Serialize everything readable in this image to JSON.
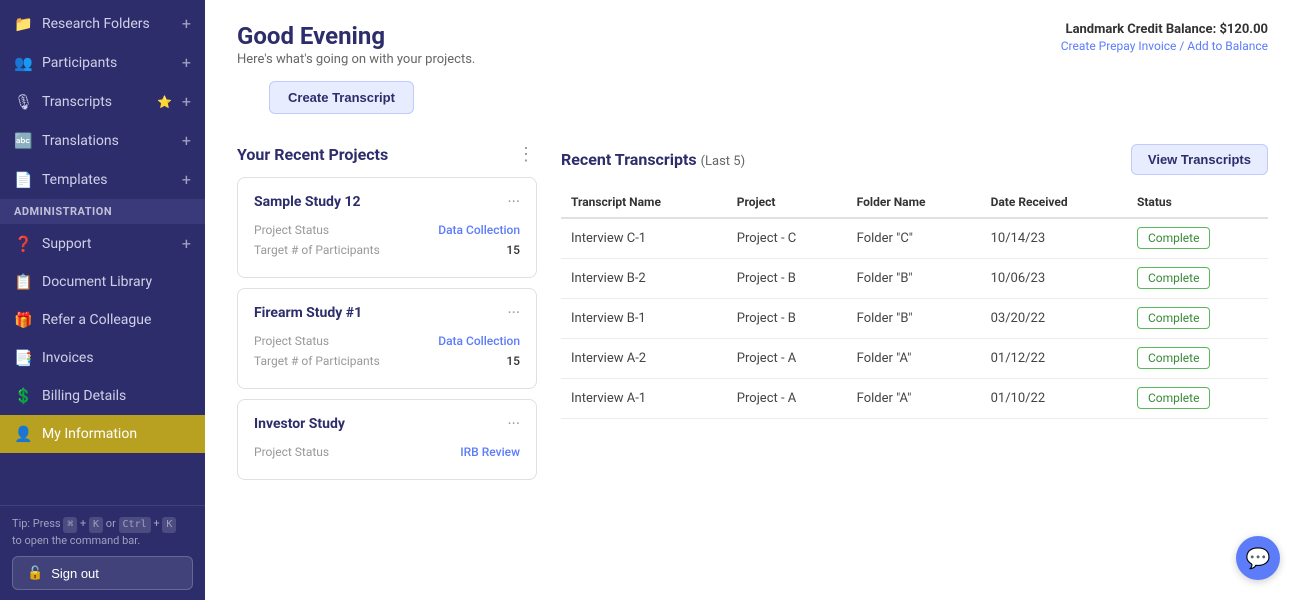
{
  "sidebar": {
    "items": [
      {
        "id": "research-folders",
        "label": "Research Folders",
        "icon": "📁",
        "has_plus": true
      },
      {
        "id": "participants",
        "label": "Participants",
        "icon": "👥",
        "has_plus": true
      },
      {
        "id": "transcripts",
        "label": "Transcripts",
        "icon": "🎙",
        "has_plus": true,
        "has_star": true
      },
      {
        "id": "translations",
        "label": "Translations",
        "icon": "🔤",
        "has_plus": true
      },
      {
        "id": "templates",
        "label": "Templates",
        "icon": "📄",
        "has_plus": true
      }
    ],
    "admin_label": "ADMINISTRATION",
    "admin_items": [
      {
        "id": "support",
        "label": "Support",
        "icon": "❓",
        "has_plus": true
      },
      {
        "id": "document-library",
        "label": "Document Library",
        "icon": "📋",
        "has_plus": false
      },
      {
        "id": "refer-colleague",
        "label": "Refer a Colleague",
        "icon": "🎁",
        "has_plus": false
      },
      {
        "id": "invoices",
        "label": "Invoices",
        "icon": "📑",
        "has_plus": false
      },
      {
        "id": "billing-details",
        "label": "Billing Details",
        "icon": "💲",
        "has_plus": false
      },
      {
        "id": "my-information",
        "label": "My Information",
        "icon": "👤",
        "has_plus": false,
        "active": true
      }
    ],
    "tip_text": "Tip: Press",
    "tip_keys": [
      "⌘",
      "K",
      "Ctrl",
      "K"
    ],
    "tip_suffix": "to open the command bar.",
    "sign_out_label": "Sign out"
  },
  "header": {
    "greeting": "Good Evening",
    "subtitle": "Here's what's going on with your projects.",
    "credit_label": "Landmark Credit Balance:",
    "credit_amount": "$120.00",
    "credit_link": "Create Prepay Invoice / Add to Balance",
    "create_btn": "Create Transcript"
  },
  "projects": {
    "title": "Your Recent Projects",
    "cards": [
      {
        "name": "Sample Study 12",
        "status_label": "Project Status",
        "status_value": "Data Collection",
        "target_label": "Target # of Participants",
        "target_value": "15"
      },
      {
        "name": "Firearm Study #1",
        "status_label": "Project Status",
        "status_value": "Data Collection",
        "target_label": "Target # of Participants",
        "target_value": "15"
      },
      {
        "name": "Investor Study",
        "status_label": "Project Status",
        "status_value": "IRB Review",
        "target_label": "",
        "target_value": ""
      }
    ]
  },
  "transcripts": {
    "title": "Recent Transcripts",
    "count_label": "(Last 5)",
    "view_btn": "View Transcripts",
    "columns": [
      "Transcript Name",
      "Project",
      "Folder Name",
      "Date Received",
      "Status"
    ],
    "rows": [
      {
        "name": "Interview C-1",
        "project": "Project - C",
        "folder": "Folder \"C\"",
        "date": "10/14/23",
        "status": "Complete"
      },
      {
        "name": "Interview B-2",
        "project": "Project - B",
        "folder": "Folder \"B\"",
        "date": "10/06/23",
        "status": "Complete"
      },
      {
        "name": "Interview B-1",
        "project": "Project - B",
        "folder": "Folder \"B\"",
        "date": "03/20/22",
        "status": "Complete"
      },
      {
        "name": "Interview A-2",
        "project": "Project - A",
        "folder": "Folder \"A\"",
        "date": "01/12/22",
        "status": "Complete"
      },
      {
        "name": "Interview A-1",
        "project": "Project - A",
        "folder": "Folder \"A\"",
        "date": "01/10/22",
        "status": "Complete"
      }
    ]
  },
  "chat_icon": "💬"
}
